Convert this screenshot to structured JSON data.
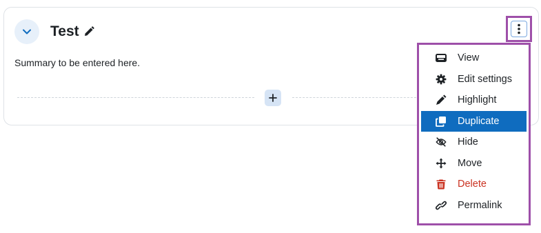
{
  "section": {
    "title": "Test",
    "summary": "Summary to be entered here."
  },
  "menu": {
    "items": [
      {
        "label": "View",
        "icon": "view-icon"
      },
      {
        "label": "Edit settings",
        "icon": "gear-icon"
      },
      {
        "label": "Highlight",
        "icon": "highlight-icon"
      },
      {
        "label": "Duplicate",
        "icon": "duplicate-icon",
        "state": "active"
      },
      {
        "label": "Hide",
        "icon": "eye-slash-icon"
      },
      {
        "label": "Move",
        "icon": "move-icon"
      },
      {
        "label": "Delete",
        "icon": "trash-icon",
        "state": "danger"
      },
      {
        "label": "Permalink",
        "icon": "link-icon"
      }
    ]
  },
  "colors": {
    "accent": "#0f6cbf",
    "danger": "#ca3120",
    "highlight_outline": "#9e4fa9"
  }
}
